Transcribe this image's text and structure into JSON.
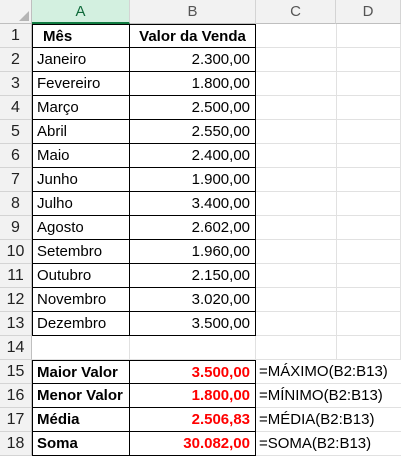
{
  "columns": [
    "A",
    "B",
    "C",
    "D"
  ],
  "header": {
    "month": "Mês",
    "value": "Valor da Venda"
  },
  "rows": [
    {
      "num": "1"
    },
    {
      "num": "2",
      "month": "Janeiro",
      "value": "2.300,00"
    },
    {
      "num": "3",
      "month": "Fevereiro",
      "value": "1.800,00"
    },
    {
      "num": "4",
      "month": "Março",
      "value": "2.500,00"
    },
    {
      "num": "5",
      "month": "Abril",
      "value": "2.550,00"
    },
    {
      "num": "6",
      "month": "Maio",
      "value": "2.400,00"
    },
    {
      "num": "7",
      "month": "Junho",
      "value": "1.900,00"
    },
    {
      "num": "8",
      "month": "Julho",
      "value": "3.400,00"
    },
    {
      "num": "9",
      "month": "Agosto",
      "value": "2.602,00"
    },
    {
      "num": "10",
      "month": "Setembro",
      "value": "1.960,00"
    },
    {
      "num": "11",
      "month": "Outubro",
      "value": "2.150,00"
    },
    {
      "num": "12",
      "month": "Novembro",
      "value": "3.020,00"
    },
    {
      "num": "13",
      "month": "Dezembro",
      "value": "3.500,00"
    },
    {
      "num": "14"
    },
    {
      "num": "15",
      "label": "Maior Valor",
      "result": "3.500,00",
      "formula": "=MÁXIMO(B2:B13)"
    },
    {
      "num": "16",
      "label": "Menor Valor",
      "result": "1.800,00",
      "formula": "=MÍNIMO(B2:B13)"
    },
    {
      "num": "17",
      "label": "Média",
      "result": "2.506,83",
      "formula": "=MÉDIA(B2:B13)"
    },
    {
      "num": "18",
      "label": "Soma",
      "result": "30.082,00",
      "formula": "=SOMA(B2:B13)"
    }
  ],
  "colors": {
    "result_text": "#ff0000",
    "selected_column_header": "#d3f0e0"
  }
}
